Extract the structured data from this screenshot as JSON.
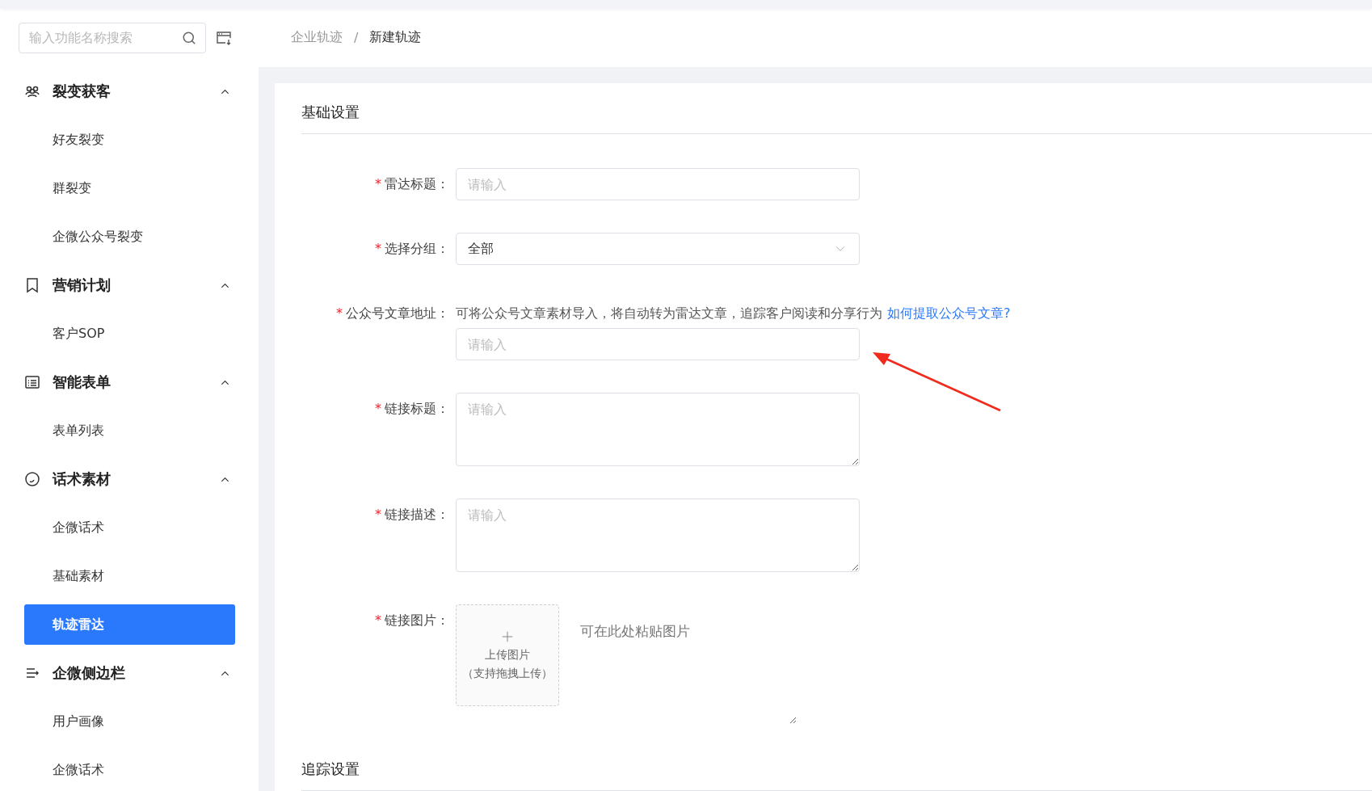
{
  "sidebar": {
    "search": {
      "placeholder": "输入功能名称搜索"
    },
    "groups": [
      {
        "label": "裂变获客",
        "kind": "people",
        "expanded": true,
        "children": [
          {
            "label": "好友裂变",
            "selected": false
          },
          {
            "label": "群裂变",
            "selected": false
          },
          {
            "label": "企微公众号裂变",
            "selected": false
          }
        ]
      },
      {
        "label": "营销计划",
        "kind": "bookmark",
        "expanded": true,
        "children": [
          {
            "label": "客户SOP",
            "selected": false
          }
        ]
      },
      {
        "label": "智能表单",
        "kind": "form",
        "expanded": true,
        "children": [
          {
            "label": "表单列表",
            "selected": false
          }
        ]
      },
      {
        "label": "话术素材",
        "kind": "circle",
        "expanded": true,
        "children": [
          {
            "label": "企微话术",
            "selected": false
          },
          {
            "label": "基础素材",
            "selected": false
          },
          {
            "label": "轨迹雷达",
            "selected": true
          }
        ]
      },
      {
        "label": "企微侧边栏",
        "kind": "menu",
        "expanded": true,
        "children": [
          {
            "label": "用户画像",
            "selected": false
          },
          {
            "label": "企微话术",
            "selected": false
          }
        ]
      }
    ]
  },
  "breadcrumb": {
    "items": [
      "企业轨迹",
      "新建轨迹"
    ],
    "separator": "/"
  },
  "sections": [
    {
      "title": "基础设置",
      "fields": [
        {
          "kind": "input",
          "label": "雷达标题：",
          "required_mark": "*",
          "placeholder": "请输入"
        },
        {
          "kind": "select",
          "label": "选择分组：",
          "required_mark": "*",
          "value": "全部"
        },
        {
          "kind": "input",
          "label": "公众号文章地址：",
          "required_mark": "*",
          "placeholder": "请输入",
          "hint": "可将公众号文章素材导入，将自动转为雷达文章，追踪客户阅读和分享行为",
          "link": "如何提取公众号文章?"
        },
        {
          "kind": "textarea",
          "label": "链接标题：",
          "required_mark": "*",
          "placeholder": "请输入"
        },
        {
          "kind": "textarea",
          "label": "链接描述：",
          "required_mark": "*",
          "placeholder": "请输入"
        },
        {
          "kind": "upload",
          "label": "链接图片：",
          "required_mark": "*",
          "upload_text": "上传图片",
          "upload_note": "（支持拖拽上传）",
          "paste_placeholder": "可在此处粘贴图片"
        }
      ]
    },
    {
      "title": "追踪设置"
    }
  ]
}
